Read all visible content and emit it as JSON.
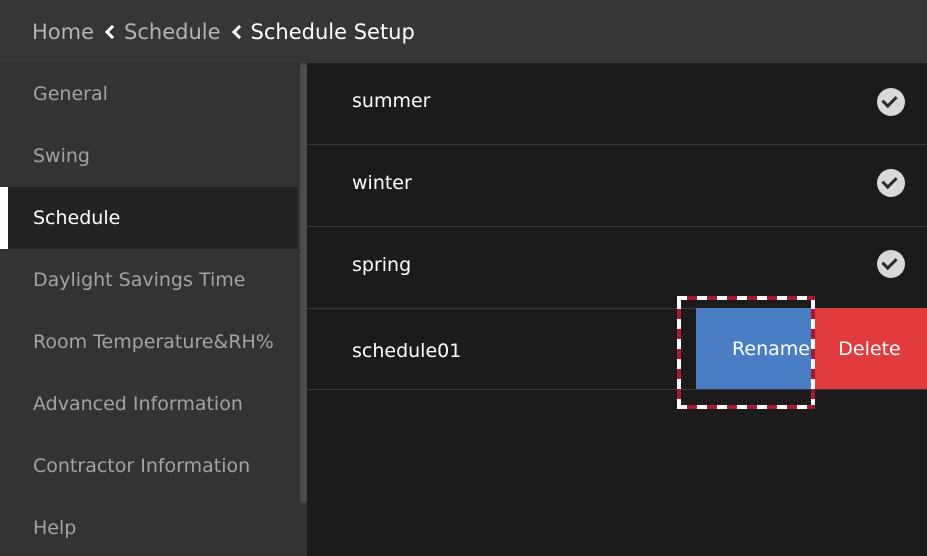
{
  "header": {
    "breadcrumb": [
      "Home",
      "Schedule",
      "Schedule Setup"
    ]
  },
  "sidebar": {
    "items": [
      {
        "label": "General",
        "active": false
      },
      {
        "label": "Swing",
        "active": false
      },
      {
        "label": "Schedule",
        "active": true
      },
      {
        "label": "Daylight Savings Time",
        "active": false
      },
      {
        "label": "Room Temperature&RH%",
        "active": false
      },
      {
        "label": "Advanced Information",
        "active": false
      },
      {
        "label": "Contractor Information",
        "active": false
      },
      {
        "label": "Help",
        "active": false
      }
    ]
  },
  "schedules": [
    {
      "name": "summer",
      "checked": true
    },
    {
      "name": "winter",
      "checked": true
    },
    {
      "name": "spring",
      "checked": true
    },
    {
      "name": "schedule01",
      "checked": false
    }
  ],
  "actions": {
    "rename_label": "Rename",
    "delete_label": "Delete"
  },
  "colors": {
    "header_bg": "#353638",
    "sidebar_bg": "#323335",
    "content_bg": "#1b1b1b",
    "rename_bg": "#4a7ec4",
    "delete_bg": "#e23b3e",
    "focus_outline": "#a6192e"
  }
}
